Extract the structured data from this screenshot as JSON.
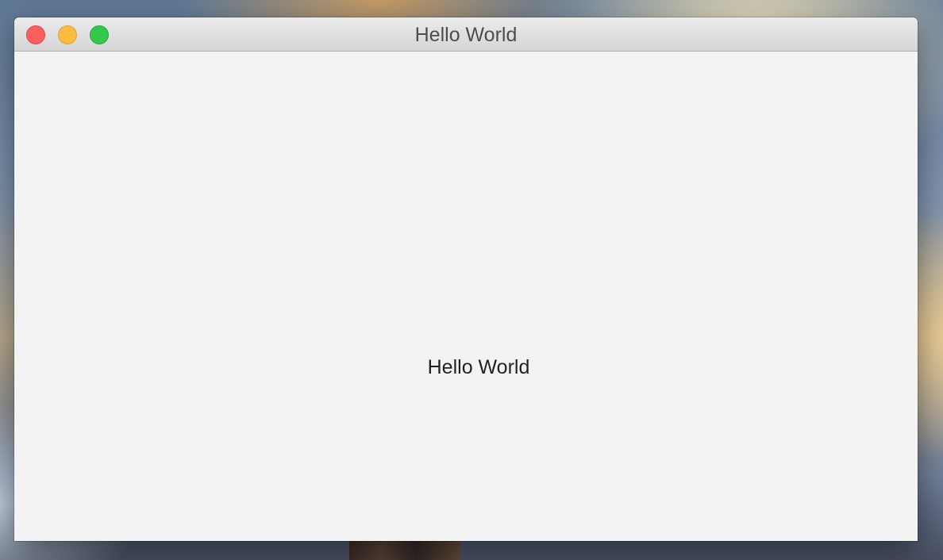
{
  "window": {
    "title": "Hello World"
  },
  "content": {
    "label": "Hello World"
  },
  "controls": {
    "close_color": "#fc605c",
    "minimize_color": "#fdbc40",
    "zoom_color": "#34c84a"
  },
  "icons": {
    "close": "close-icon",
    "minimize": "minimize-icon",
    "zoom": "zoom-icon"
  }
}
